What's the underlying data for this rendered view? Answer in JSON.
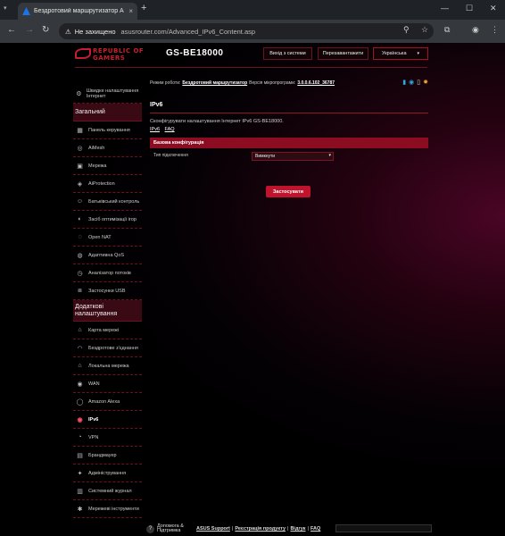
{
  "browser": {
    "tab_title": "Бездротовий маршрутизатор А",
    "url_warning": "Не захищено",
    "url": "asusrouter.com/Advanced_IPv6_Content.asp",
    "new_tab": "+",
    "tab_close": "×",
    "tab_list": "▾",
    "win_min": "—",
    "win_max": "☐",
    "win_close": "✕",
    "nav_back": "←",
    "nav_forward": "→",
    "nav_reload": "↻",
    "warn_glyph": "⚠",
    "zoom_glyph": "⚲",
    "star_glyph": "☆",
    "ext_glyph": "⧉",
    "profile_glyph": "◉",
    "menu_glyph": "⋮",
    "tab_favicon_color": "#1a73e8"
  },
  "header": {
    "logo_line1": "REPUBLIC OF",
    "logo_line2": "GAMERS",
    "model": "GS-BE18000",
    "logout_label": "Вихід з системи",
    "reboot_label": "Перезавантажити",
    "language_label": "Українська",
    "language_caret": "▾"
  },
  "status": {
    "mode_label": "Режим роботи:",
    "mode_value": "Бездротовий маршрутизатор",
    "firmware_label": "Версія мікропрограми:",
    "firmware_value": "3.0.0.6.102_36787",
    "icons": [
      "network-icon",
      "usb-icon",
      "link-icon",
      "settings-gear-icon"
    ]
  },
  "sidebar": {
    "quick_setup": "Швидке налаштування Інтернет",
    "general_header": "Загальний",
    "general_items": [
      {
        "label": "Панель керування",
        "icon": "dashboard-icon",
        "glyph": "▦"
      },
      {
        "label": "AiMesh",
        "icon": "aimesh-icon",
        "glyph": "◎"
      },
      {
        "label": "Мережа",
        "icon": "network-icon",
        "glyph": "▣"
      },
      {
        "label": "AiProtection",
        "icon": "shield-icon",
        "glyph": "◈"
      },
      {
        "label": "Батьківський контроль",
        "icon": "parental-icon",
        "glyph": "☺"
      },
      {
        "label": "Засіб оптимізації ігор",
        "icon": "game-boost-icon",
        "glyph": "◐"
      },
      {
        "label": "Open NAT",
        "icon": "open-nat-icon",
        "glyph": "◌"
      },
      {
        "label": "Адаптивна QoS",
        "icon": "qos-icon",
        "glyph": "◍"
      },
      {
        "label": "Аналізатор потоків",
        "icon": "traffic-analyzer-icon",
        "glyph": "◷"
      },
      {
        "label": "Застосунки USB",
        "icon": "usb-icon",
        "glyph": "⧈"
      }
    ],
    "advanced_header": "Додаткові налаштування",
    "advanced_items": [
      {
        "label": "Карта мережі",
        "icon": "network-map-icon",
        "glyph": "⌂"
      },
      {
        "label": "Бездротове з'єднання",
        "icon": "wireless-icon",
        "glyph": "◠"
      },
      {
        "label": "Локальна мережа",
        "icon": "lan-icon",
        "glyph": "⌂"
      },
      {
        "label": "WAN",
        "icon": "wan-icon",
        "glyph": "◉"
      },
      {
        "label": "Amazon Alexa",
        "icon": "alexa-icon",
        "glyph": "◯"
      },
      {
        "label": "IPv6",
        "icon": "ipv6-icon",
        "glyph": "◉",
        "active": true
      },
      {
        "label": "VPN",
        "icon": "vpn-icon",
        "glyph": "◔"
      },
      {
        "label": "Брандмауер",
        "icon": "firewall-icon",
        "glyph": "▤"
      },
      {
        "label": "Адміністрування",
        "icon": "admin-icon",
        "glyph": "✦"
      },
      {
        "label": "Системний журнал",
        "icon": "system-log-icon",
        "glyph": "▥"
      },
      {
        "label": "Мережеві інструменти",
        "icon": "network-tools-icon",
        "glyph": "✱"
      }
    ]
  },
  "main": {
    "title": "IPv6",
    "description": "Сконфігурувати налаштування Інтернет IPv6 GS-BE18000.",
    "link_ipv6": "IPv6",
    "link_faq": "FAQ",
    "config_header": "Базова конфігурація",
    "connection_type_label": "Тип підключення",
    "connection_type_value": "Вимкнути",
    "select_caret": "▾",
    "apply_label": "Застосувати"
  },
  "footer": {
    "help_label": "Допомога & Підтримка",
    "links": [
      "ASUS Support",
      "Реєстрація продукту",
      "Відгук",
      "FAQ"
    ],
    "separator": "|",
    "help_glyph": "?"
  },
  "colors": {
    "accent": "#c0142e",
    "header_bar": "#8c0d22",
    "sidebar_header_bg": "#3a0a14"
  }
}
